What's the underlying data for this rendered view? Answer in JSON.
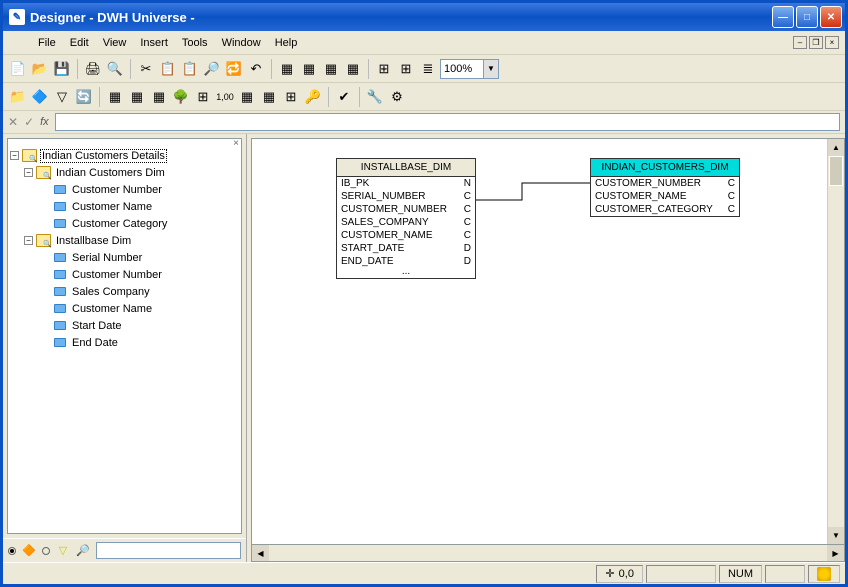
{
  "window_title": "Designer - DWH Universe -",
  "menu": {
    "file": "File",
    "edit": "Edit",
    "view": "View",
    "insert": "Insert",
    "tools": "Tools",
    "window": "Window",
    "help": "Help"
  },
  "zoom": "100%",
  "tree": {
    "root": "Indian Customers Details",
    "group1": {
      "label": "Indian Customers Dim",
      "items": [
        "Customer Number",
        "Customer Name",
        "Customer Category"
      ]
    },
    "group2": {
      "label": "Installbase Dim",
      "items": [
        "Serial Number",
        "Customer Number",
        "Sales Company",
        "Customer Name",
        "Start Date",
        "End Date"
      ]
    }
  },
  "table1": {
    "title": "INSTALLBASE_DIM",
    "cols": [
      {
        "name": "IB_PK",
        "type": "N"
      },
      {
        "name": "SERIAL_NUMBER",
        "type": "C"
      },
      {
        "name": "CUSTOMER_NUMBER",
        "type": "C"
      },
      {
        "name": "SALES_COMPANY",
        "type": "C"
      },
      {
        "name": "CUSTOMER_NAME",
        "type": "C"
      },
      {
        "name": "START_DATE",
        "type": "D"
      },
      {
        "name": "END_DATE",
        "type": "D"
      }
    ],
    "more": "..."
  },
  "table2": {
    "title": "INDIAN_CUSTOMERS_DIM",
    "cols": [
      {
        "name": "CUSTOMER_NUMBER",
        "type": "C"
      },
      {
        "name": "CUSTOMER_NAME",
        "type": "C"
      },
      {
        "name": "CUSTOMER_CATEGORY",
        "type": "C"
      }
    ]
  },
  "status": {
    "coord_label": "",
    "coord": "0,0",
    "num": "NUM"
  }
}
